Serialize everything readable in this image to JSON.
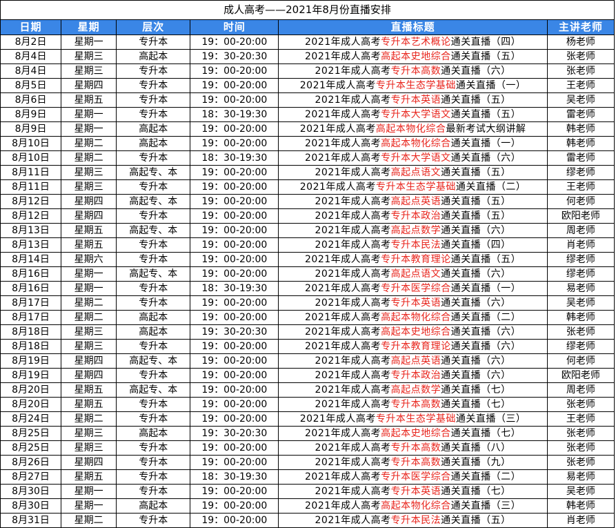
{
  "title": "成人高考——2021年8月份直播安排",
  "headers": [
    "日期",
    "星期",
    "层次",
    "时间",
    "直播标题",
    "主讲老师"
  ],
  "rows": [
    {
      "date": "8月2日",
      "weekday": "星期一",
      "level": "专升本",
      "time": "19：00-20:00",
      "pre": "2021年成人高考",
      "subject": "专升本艺术概论",
      "post": "通关直播（四）",
      "teacher": "杨老师"
    },
    {
      "date": "8月4日",
      "weekday": "星期三",
      "level": "高起本",
      "time": "19：30-20:30",
      "pre": "2021年成人高考",
      "subject": "高起本史地综合",
      "post": "通关直播（五）",
      "teacher": "张老师"
    },
    {
      "date": "8月4日",
      "weekday": "星期三",
      "level": "专升本",
      "time": "19：00-20:00",
      "pre": "2021年成人高考",
      "subject": "专升本高数",
      "post": "通关直播（六）",
      "teacher": "张老师"
    },
    {
      "date": "8月5日",
      "weekday": "星期四",
      "level": "专升本",
      "time": "19：00-20:00",
      "pre": "2021年成人高考",
      "subject": "专升本生态学基础",
      "post": "通关直播（一）",
      "teacher": "王老师"
    },
    {
      "date": "8月6日",
      "weekday": "星期五",
      "level": "专升本",
      "time": "19：00-20:00",
      "pre": "2021年成人高考",
      "subject": "专升本英语",
      "post": "通关直播（五）",
      "teacher": "吴老师"
    },
    {
      "date": "8月9日",
      "weekday": "星期一",
      "level": "专升本",
      "time": "18：30-19:30",
      "pre": "2021年成人高考",
      "subject": "专升本大学语文",
      "post": "通关直播（五）",
      "teacher": "雷老师"
    },
    {
      "date": "8月9日",
      "weekday": "星期一",
      "level": "高起本",
      "time": "19：00-20:00",
      "pre": "2021年成人高考",
      "subject": "高起本物化综合",
      "post": "最新考试大纲讲解",
      "teacher": "韩老师"
    },
    {
      "date": "8月10日",
      "weekday": "星期二",
      "level": "高起本",
      "time": "19：00-20:00",
      "pre": "2021年成人高考",
      "subject": "高起本物化综合",
      "post": "通关直播（一）",
      "teacher": "韩老师"
    },
    {
      "date": "8月10日",
      "weekday": "星期二",
      "level": "专升本",
      "time": "18：30-19:30",
      "pre": "2021年成人高考",
      "subject": "专升本大学语文",
      "post": "通关直播（六）",
      "teacher": "雷老师"
    },
    {
      "date": "8月11日",
      "weekday": "星期三",
      "level": "高起专、本",
      "time": "19：00-20:00",
      "pre": "2021年成人高考",
      "subject": "高起点语文",
      "post": "通关直播（五）",
      "teacher": "缪老师"
    },
    {
      "date": "8月11日",
      "weekday": "星期三",
      "level": "专升本",
      "time": "19：00-20:00",
      "pre": "2021年成人高考",
      "subject": "专升本生态学基础",
      "post": "通关直播（二）",
      "teacher": "王老师"
    },
    {
      "date": "8月12日",
      "weekday": "星期四",
      "level": "高起专、本",
      "time": "19：00-20:00",
      "pre": "2021年成人高考",
      "subject": "高起点英语",
      "post": "通关直播（五）",
      "teacher": "何老师"
    },
    {
      "date": "8月12日",
      "weekday": "星期四",
      "level": "专升本",
      "time": "19：00-20:00",
      "pre": "2021年成人高考",
      "subject": "专升本政治",
      "post": "通关直播（五）",
      "teacher": "欧阳老师"
    },
    {
      "date": "8月13日",
      "weekday": "星期五",
      "level": "高起专、本",
      "time": "19：00-20:00",
      "pre": "2021年成人高考",
      "subject": "高起点数学",
      "post": "通关直播（六）",
      "teacher": "周老师"
    },
    {
      "date": "8月13日",
      "weekday": "星期五",
      "level": "专升本",
      "time": "19：00-20:00",
      "pre": "2021年成人高考",
      "subject": "专升本民法",
      "post": "通关直播（四）",
      "teacher": "肖老师"
    },
    {
      "date": "8月14日",
      "weekday": "星期六",
      "level": "专升本",
      "time": "19：00-20:00",
      "pre": "2021年成人高考",
      "subject": "专升本教育理论",
      "post": "通关直播（五）",
      "teacher": "缪老师"
    },
    {
      "date": "8月16日",
      "weekday": "星期一",
      "level": "高起专、本",
      "time": "19：00-20:00",
      "pre": "2021年成人高考",
      "subject": "高起点语文",
      "post": "通关直播（六）",
      "teacher": "缪老师"
    },
    {
      "date": "8月16日",
      "weekday": "星期一",
      "level": "专升本",
      "time": "18：30-19:30",
      "pre": "2021年成人高考",
      "subject": "专升本医学综合",
      "post": "通关直播（一）",
      "teacher": "易老师"
    },
    {
      "date": "8月17日",
      "weekday": "星期二",
      "level": "专升本",
      "time": "19：00-20:00",
      "pre": "2021年成人高考",
      "subject": "专升本英语",
      "post": "通关直播（六）",
      "teacher": "吴老师"
    },
    {
      "date": "8月17日",
      "weekday": "星期二",
      "level": "高起本",
      "time": "19：00-20:00",
      "pre": "2021年成人高考",
      "subject": "高起本物化综合",
      "post": "通关直播（二）",
      "teacher": "韩老师"
    },
    {
      "date": "8月18日",
      "weekday": "星期三",
      "level": "高起本",
      "time": "19：30-20:30",
      "pre": "2021年成人高考",
      "subject": "高起本史地综合",
      "post": "通关直播（六）",
      "teacher": "张老师"
    },
    {
      "date": "8月18日",
      "weekday": "星期三",
      "level": "专升本",
      "time": "19：00-20:00",
      "pre": "2021年成人高考",
      "subject": "专升本教育理论",
      "post": "通关直播（六）",
      "teacher": "缪老师"
    },
    {
      "date": "8月19日",
      "weekday": "星期四",
      "level": "高起专、本",
      "time": "19：00-20:00",
      "pre": "2021年成人高考",
      "subject": "高起点英语",
      "post": "通关直播（六）",
      "teacher": "何老师"
    },
    {
      "date": "8月19日",
      "weekday": "星期四",
      "level": "专升本",
      "time": "19：00-20:00",
      "pre": "2021年成人高考",
      "subject": "专升本政治",
      "post": "通关直播（六）",
      "teacher": "欧阳老师"
    },
    {
      "date": "8月20日",
      "weekday": "星期五",
      "level": "高起专、本",
      "time": "19：00-20:00",
      "pre": "2021年成人高考",
      "subject": "高起点数学",
      "post": "通关直播（七）",
      "teacher": "周老师"
    },
    {
      "date": "8月20日",
      "weekday": "星期五",
      "level": "专升本",
      "time": "19：00-20:00",
      "pre": "2021年成人高考",
      "subject": "专升本高数",
      "post": "通关直播（七）",
      "teacher": "张老师"
    },
    {
      "date": "8月24日",
      "weekday": "星期二",
      "level": "专升本",
      "time": "19：00-20:00",
      "pre": "2021年成人高考",
      "subject": "专升本生态学基础",
      "post": "通关直播（三）",
      "teacher": "王老师"
    },
    {
      "date": "8月25日",
      "weekday": "星期三",
      "level": "高起本",
      "time": "19：30-20:30",
      "pre": "2021年成人高考",
      "subject": "高起本史地综合",
      "post": "通关直播（七）",
      "teacher": "张老师"
    },
    {
      "date": "8月25日",
      "weekday": "星期三",
      "level": "专升本",
      "time": "19：00-20:00",
      "pre": "2021年成人高考",
      "subject": "专升本高数",
      "post": "通关直播（八）",
      "teacher": "张老师"
    },
    {
      "date": "8月26日",
      "weekday": "星期四",
      "level": "专升本",
      "time": "19：00-20:00",
      "pre": "2021年成人高考",
      "subject": "专升本高数",
      "post": "通关直播（九）",
      "teacher": "张老师"
    },
    {
      "date": "8月27日",
      "weekday": "星期五",
      "level": "专升本",
      "time": "18：30-19:30",
      "pre": "2021年成人高考",
      "subject": "专升本医学综合",
      "post": "通关直播（二）",
      "teacher": "易老师"
    },
    {
      "date": "8月30日",
      "weekday": "星期一",
      "level": "专升本",
      "time": "19：00-20:00",
      "pre": "2021年成人高考",
      "subject": "专升本英语",
      "post": "通关直播（七）",
      "teacher": "吴老师"
    },
    {
      "date": "8月30日",
      "weekday": "星期一",
      "level": "高起本",
      "time": "19：00-20:00",
      "pre": "2021年成人高考",
      "subject": "高起本物化综合",
      "post": "通关直播（三）",
      "teacher": "韩老师"
    },
    {
      "date": "8月31日",
      "weekday": "星期二",
      "level": "专升本",
      "time": "19：00-20:00",
      "pre": "2021年成人高考",
      "subject": "专升本民法",
      "post": "通关直播（五）",
      "teacher": "肖老师"
    }
  ],
  "colors": {
    "header_bg": "#3a86e6",
    "header_text": "#ffffff",
    "highlight": "#e8241c",
    "text": "#000000"
  }
}
